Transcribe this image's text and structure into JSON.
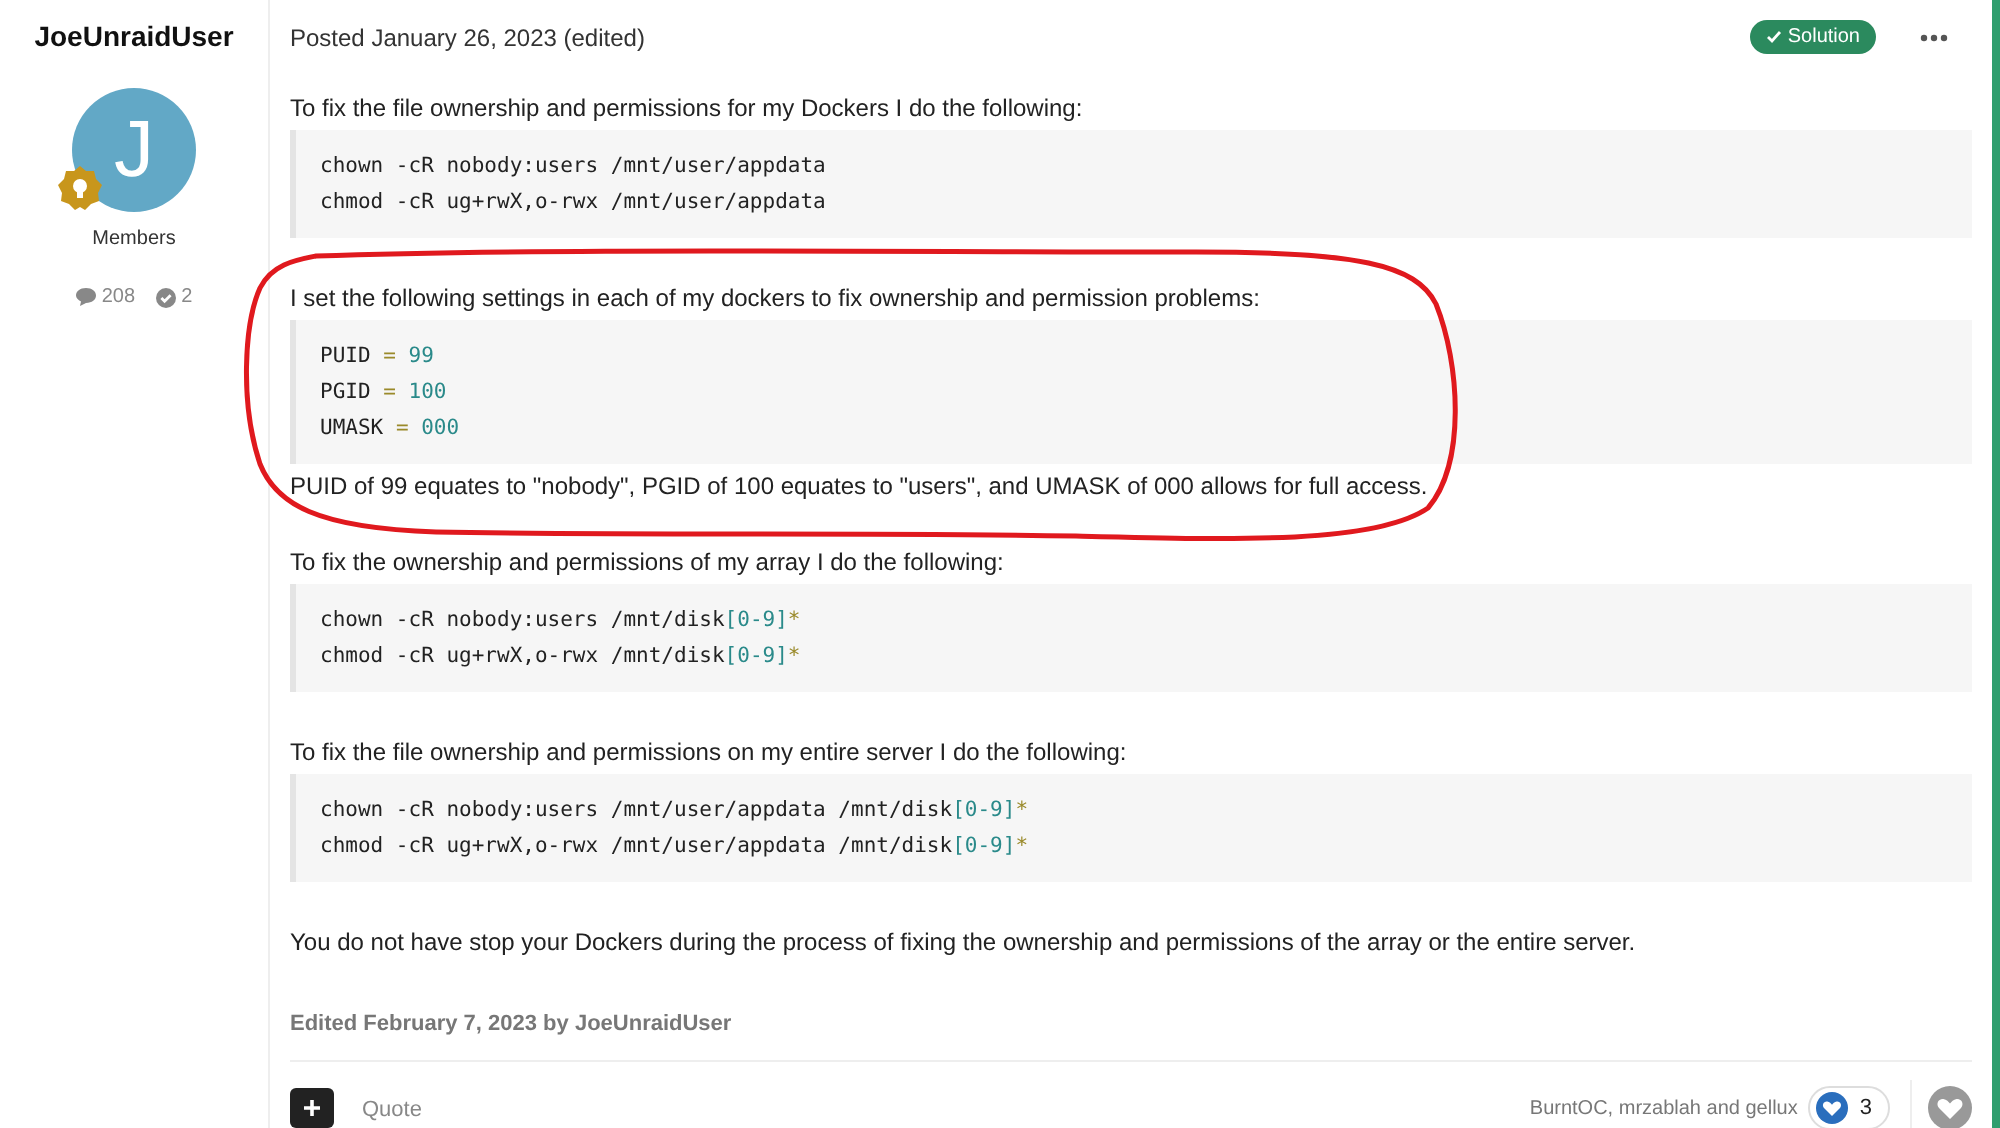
{
  "author": {
    "name": "JoeUnraidUser",
    "avatar_letter": "J",
    "group": "Members",
    "posts": "208",
    "solutions": "2"
  },
  "post": {
    "posted": "Posted January 26, 2023 (edited)",
    "solution_badge": "Solution",
    "blocks": [
      {
        "kind": "text",
        "text": "To fix the file ownership and permissions for my Dockers I do the following:"
      },
      {
        "kind": "code",
        "lines": [
          "chown -cR nobody:users /mnt/user/appdata",
          "chmod -cR ug+rwX,o-rwx /mnt/user/appdata"
        ]
      },
      {
        "kind": "text",
        "text": "I set the following settings in each of my dockers to fix ownership and permission problems:"
      },
      {
        "kind": "code",
        "lines": [
          "PUID = 99",
          "PGID = 100",
          "UMASK = 000"
        ]
      },
      {
        "kind": "caption",
        "text": "PUID of 99 equates to \"nobody\", PGID of 100 equates to \"users\", and UMASK of 000 allows for full access."
      },
      {
        "kind": "text",
        "text": "To fix the ownership and permissions of my array I do the following:"
      },
      {
        "kind": "code",
        "lines": [
          "chown -cR nobody:users /mnt/disk[0-9]*",
          "chmod -cR ug+rwX,o-rwx /mnt/disk[0-9]*"
        ]
      },
      {
        "kind": "text",
        "text": "To fix the file ownership and permissions on my entire server I do the following:"
      },
      {
        "kind": "code",
        "lines": [
          "chown -cR nobody:users /mnt/user/appdata /mnt/disk[0-9]*",
          "chmod -cR ug+rwX,o-rwx /mnt/user/appdata /mnt/disk[0-9]*"
        ]
      },
      {
        "kind": "text",
        "text": "You do not have stop your Dockers during the process of fixing the ownership and permissions of the array or the entire server."
      }
    ],
    "edited": "Edited February 7, 2023 by JoeUnraidUser"
  },
  "footer": {
    "quote": "Quote",
    "reactors": "BurntOC, mrzablah and gellux",
    "reaction_count": "3"
  }
}
